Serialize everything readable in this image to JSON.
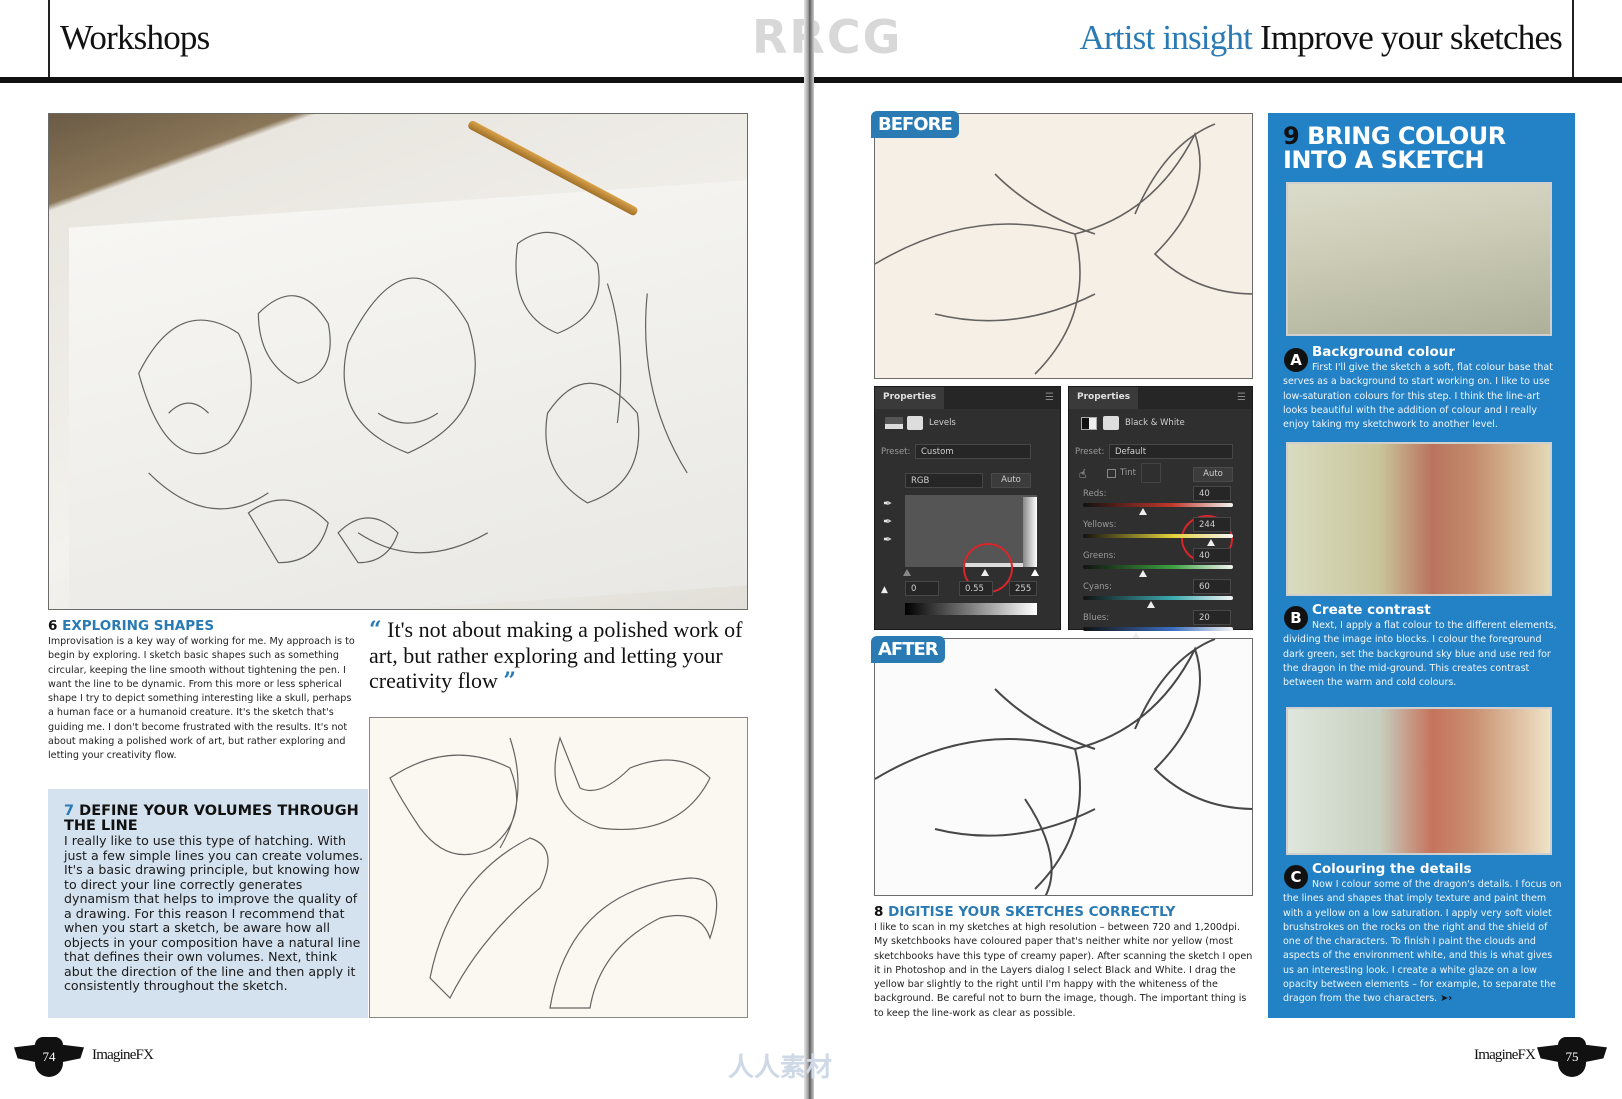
{
  "header": {
    "left_section": "Workshops",
    "watermark": "RRCG",
    "right_accent": "Artist insight",
    "right_title": "Improve your sketches"
  },
  "left_page": {
    "step6": {
      "number": "6",
      "title": "EXPLORING SHAPES",
      "body": "Improvisation is a key way of working for me. My approach is to begin by exploring. I sketch basic shapes such as something circular, keeping the line smooth without tightening the pen. I want the line to be dynamic. From this more or less spherical shape I try to depict something interesting like a skull, perhaps a human face or a humanoid creature. It's the sketch that's guiding me. I don't become frustrated with the results. It's not about making a polished work of art, but rather exploring and letting your creativity flow."
    },
    "quote": {
      "open": "“",
      "text": "It's not about making a polished work of art, but rather exploring and letting your creativity flow",
      "close": "”"
    },
    "step7": {
      "number": "7",
      "title": "DEFINE YOUR VOLUMES THROUGH THE LINE",
      "body": "I really like to use this type of hatching. With just a few simple lines you can create volumes. It's a basic drawing principle, but knowing how to direct your line correctly generates dynamism that helps to improve the quality of a drawing. For this reason I recommend that when you start a sketch, be aware how all objects in your composition have a natural line that defines their own volumes. Next, think abut the direction of the line and then apply it consistently throughout the sketch."
    },
    "page_number": "74",
    "magazine": "ImagineFX"
  },
  "right_page": {
    "before_label": "BEFORE",
    "after_label": "AFTER",
    "levels_panel": {
      "tab": "Properties",
      "adjustment": "Levels",
      "preset_label": "Preset:",
      "preset_value": "Custom",
      "channel": "RGB",
      "auto": "Auto",
      "input_black": "0",
      "input_mid": "0.55",
      "input_white": "255"
    },
    "bw_panel": {
      "tab": "Properties",
      "adjustment": "Black & White",
      "preset_label": "Preset:",
      "preset_value": "Default",
      "tint_label": "Tint",
      "auto": "Auto",
      "sliders": [
        {
          "label": "Reds:",
          "value": "40",
          "color": "#c0392b",
          "position": 0.4
        },
        {
          "label": "Yellows:",
          "value": "244",
          "color": "#e3d23a",
          "position": 0.85
        },
        {
          "label": "Greens:",
          "value": "40",
          "color": "#3ca040",
          "position": 0.4
        },
        {
          "label": "Cyans:",
          "value": "60",
          "color": "#3aaab0",
          "position": 0.45
        },
        {
          "label": "Blues:",
          "value": "20",
          "color": "#3a6fc0",
          "position": 0.35
        }
      ]
    },
    "step8": {
      "number": "8",
      "title": "DIGITISE YOUR SKETCHES CORRECTLY",
      "body": "I like to scan in my sketches at high resolution – between 720 and 1,200dpi. My sketchbooks have coloured paper that's neither white nor yellow (most sketchbooks have this type of creamy paper). After scanning the sketch I open it in Photoshop and in the Layers dialog I select Black and White. I drag the yellow bar slightly to the right until I'm happy with the whiteness of the background. Be careful not to burn the image, though. The important thing is to keep the line-work as clear as possible."
    },
    "step9": {
      "number": "9",
      "title": "BRING COLOUR INTO A SKETCH",
      "substeps": [
        {
          "letter": "A",
          "title": "Background colour",
          "body": "First I'll give the sketch a soft, flat colour base that serves as a background to start working on. I like to use low-saturation colours for this step. I think the line-art looks beautiful with the addition of colour and I really enjoy taking my sketchwork to another level."
        },
        {
          "letter": "B",
          "title": "Create contrast",
          "body": "Next, I apply a flat colour to the different elements, dividing the image into blocks. I colour the foreground dark green, set the background sky blue and use red for the dragon in the mid-ground. This creates contrast between the warm and cold colours."
        },
        {
          "letter": "C",
          "title": "Colouring the details",
          "body": "Now I colour some of the dragon's details. I focus on the lines and shapes that imply texture and paint them with a yellow on a low saturation. I apply very soft violet brushstrokes on the rocks on the right and the shield of one of the characters. To finish I paint the clouds and aspects of the environment white, and this is what gives us an interesting look. I create a white glaze on a low opacity between elements – for example, to separate the dragon from the two characters."
        }
      ],
      "continue_arrow": "➤›"
    },
    "page_number": "75",
    "magazine": "ImagineFX"
  },
  "footer_watermark": "人人素材",
  "colors": {
    "accent_blue": "#2a7ab4",
    "sidebar_blue": "#2381c6",
    "box_blue": "#d4e2ef",
    "highlight_red": "#d9252a"
  }
}
